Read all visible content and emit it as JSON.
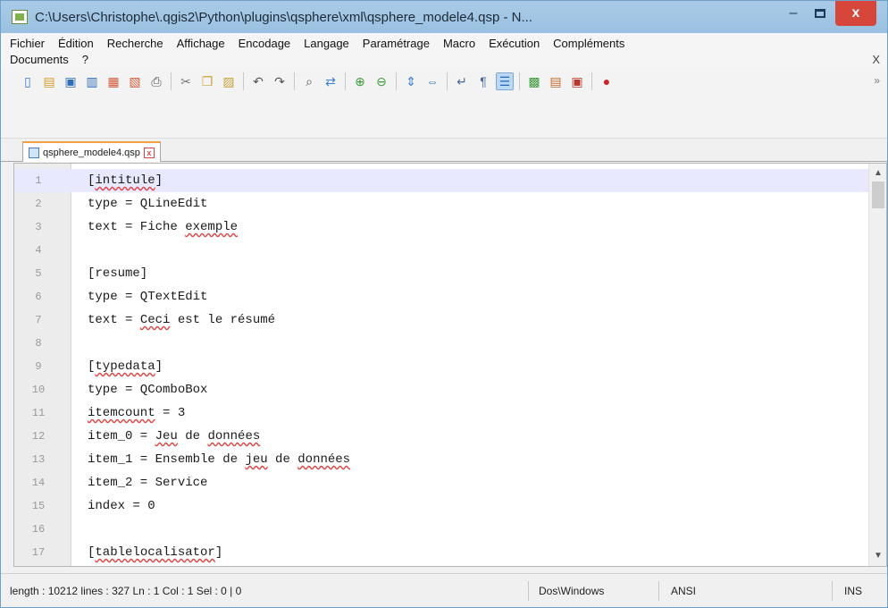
{
  "window": {
    "title": "C:\\Users\\Christophe\\.qgis2\\Python\\plugins\\qsphere\\xml\\qsphere_modele4.qsp - N...",
    "close_glyph": "x",
    "minimize_glyph": "–"
  },
  "menu": {
    "row1": [
      "Fichier",
      "Édition",
      "Recherche",
      "Affichage",
      "Encodage",
      "Langage",
      "Paramétrage",
      "Macro",
      "Exécution",
      "Compléments"
    ],
    "row2": [
      "Documents",
      "?"
    ],
    "close_glyph": "X"
  },
  "toolbar": {
    "icons": [
      {
        "name": "new-file-icon",
        "glyph": "▯"
      },
      {
        "name": "open-file-icon",
        "glyph": "▤"
      },
      {
        "name": "save-icon",
        "glyph": "▣"
      },
      {
        "name": "save-all-icon",
        "glyph": "▥"
      },
      {
        "name": "close-file-icon",
        "glyph": "▦"
      },
      {
        "name": "close-all-icon",
        "glyph": "▧"
      },
      {
        "name": "print-icon",
        "glyph": "⎙"
      },
      {
        "name": "cut-icon",
        "glyph": "✂"
      },
      {
        "name": "copy-icon",
        "glyph": "❐"
      },
      {
        "name": "paste-icon",
        "glyph": "▨"
      },
      {
        "name": "undo-icon",
        "glyph": "↶"
      },
      {
        "name": "redo-icon",
        "glyph": "↷"
      },
      {
        "name": "find-icon",
        "glyph": "⌕"
      },
      {
        "name": "replace-icon",
        "glyph": "⇄"
      },
      {
        "name": "zoom-in-icon",
        "glyph": "⊕"
      },
      {
        "name": "zoom-out-icon",
        "glyph": "⊖"
      },
      {
        "name": "sync-vertical-icon",
        "glyph": "⇕"
      },
      {
        "name": "sync-horizontal-icon",
        "glyph": "⇔"
      },
      {
        "name": "word-wrap-icon",
        "glyph": "↵"
      },
      {
        "name": "show-all-chars-icon",
        "glyph": "¶"
      },
      {
        "name": "indent-guide-icon",
        "glyph": "☰"
      },
      {
        "name": "doc-map-icon",
        "glyph": "▩"
      },
      {
        "name": "function-list-icon",
        "glyph": "▤"
      },
      {
        "name": "folder-workspace-icon",
        "glyph": "▣"
      },
      {
        "name": "record-macro-icon",
        "glyph": "●"
      }
    ],
    "more_glyph": "»"
  },
  "tab": {
    "label": "qsphere_modele4.qsp",
    "close_glyph": "x"
  },
  "editor": {
    "lines": [
      {
        "n": "1",
        "text": "[intitule]"
      },
      {
        "n": "2",
        "text": "type = QLineEdit"
      },
      {
        "n": "3",
        "text": "text = Fiche exemple"
      },
      {
        "n": "4",
        "text": ""
      },
      {
        "n": "5",
        "text": "[resume]"
      },
      {
        "n": "6",
        "text": "type = QTextEdit"
      },
      {
        "n": "7",
        "text": "text = Ceci est le résumé"
      },
      {
        "n": "8",
        "text": ""
      },
      {
        "n": "9",
        "text": "[typedata]"
      },
      {
        "n": "10",
        "text": "type = QComboBox"
      },
      {
        "n": "11",
        "text": "itemcount = 3"
      },
      {
        "n": "12",
        "text": "item_0 = Jeu de données"
      },
      {
        "n": "13",
        "text": "item_1 = Ensemble de jeu de données"
      },
      {
        "n": "14",
        "text": "item_2 = Service"
      },
      {
        "n": "15",
        "text": "index = 0"
      },
      {
        "n": "16",
        "text": ""
      },
      {
        "n": "17",
        "text": "[tablelocalisator]"
      }
    ],
    "scroll_up_glyph": "▲",
    "scroll_down_glyph": "▼"
  },
  "status": {
    "info": "length : 10212   lines : 327   Ln : 1   Col : 1   Sel : 0 | 0",
    "eol": "Dos\\Windows",
    "encoding": "ANSI",
    "mode": "INS"
  }
}
